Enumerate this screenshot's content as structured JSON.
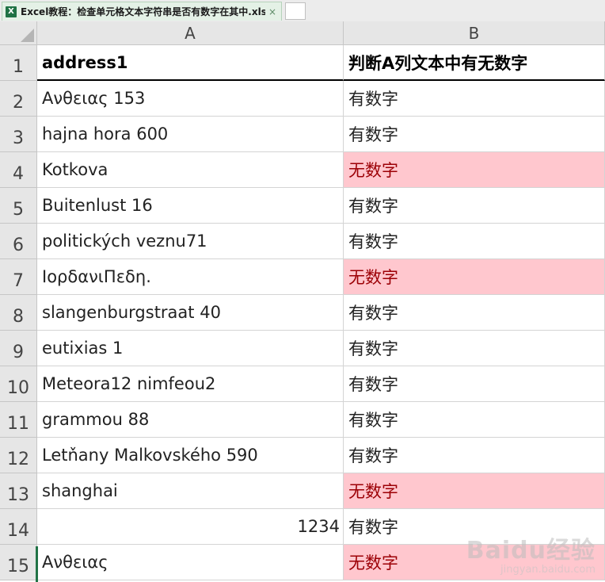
{
  "window": {
    "tab_title": "Excel教程：检查单元格文本字符串是否有数字在其中.xlsx",
    "app_icon_glyph": "X",
    "close_glyph": "×"
  },
  "columns": [
    "A",
    "B"
  ],
  "rows": [
    {
      "num": "1",
      "a": "address1",
      "b": "判断A列文本中有无数字",
      "header": true
    },
    {
      "num": "2",
      "a": "Ανθειας 153",
      "b": "有数字"
    },
    {
      "num": "3",
      "a": "hajna hora 600",
      "b": "有数字"
    },
    {
      "num": "4",
      "a": "Kotkova",
      "b": "无数字",
      "b_highlight": true
    },
    {
      "num": "5",
      "a": "Buitenlust 16",
      "b": "有数字"
    },
    {
      "num": "6",
      "a": "politických veznu71",
      "b": "有数字"
    },
    {
      "num": "7",
      "a": "ΙορδανιΠεδη.",
      "b": "无数字",
      "b_highlight": true
    },
    {
      "num": "8",
      "a": "slangenburgstraat 40",
      "b": "有数字"
    },
    {
      "num": "9",
      "a": "eutixias 1",
      "b": "有数字"
    },
    {
      "num": "10",
      "a": "Meteora12 nimfeou2",
      "b": "有数字"
    },
    {
      "num": "11",
      "a": "grammou 88",
      "b": "有数字"
    },
    {
      "num": "12",
      "a": "Letňany Malkovského 590",
      "b": "有数字"
    },
    {
      "num": "13",
      "a": "shanghai",
      "b": "无数字",
      "b_highlight": true
    },
    {
      "num": "14",
      "a": "1234",
      "b": "有数字",
      "a_numeric": true
    },
    {
      "num": "15",
      "a": "Ανθειας",
      "b": "无数字",
      "b_highlight": true
    }
  ],
  "colors": {
    "highlight_fill": "#ffc7ce",
    "highlight_text": "#9c0006",
    "tab_fill": "#e4f1e6",
    "excel_green": "#1f7244"
  },
  "watermark": {
    "logo": "Baidu经验",
    "sub": "jingyan.baidu.com"
  }
}
